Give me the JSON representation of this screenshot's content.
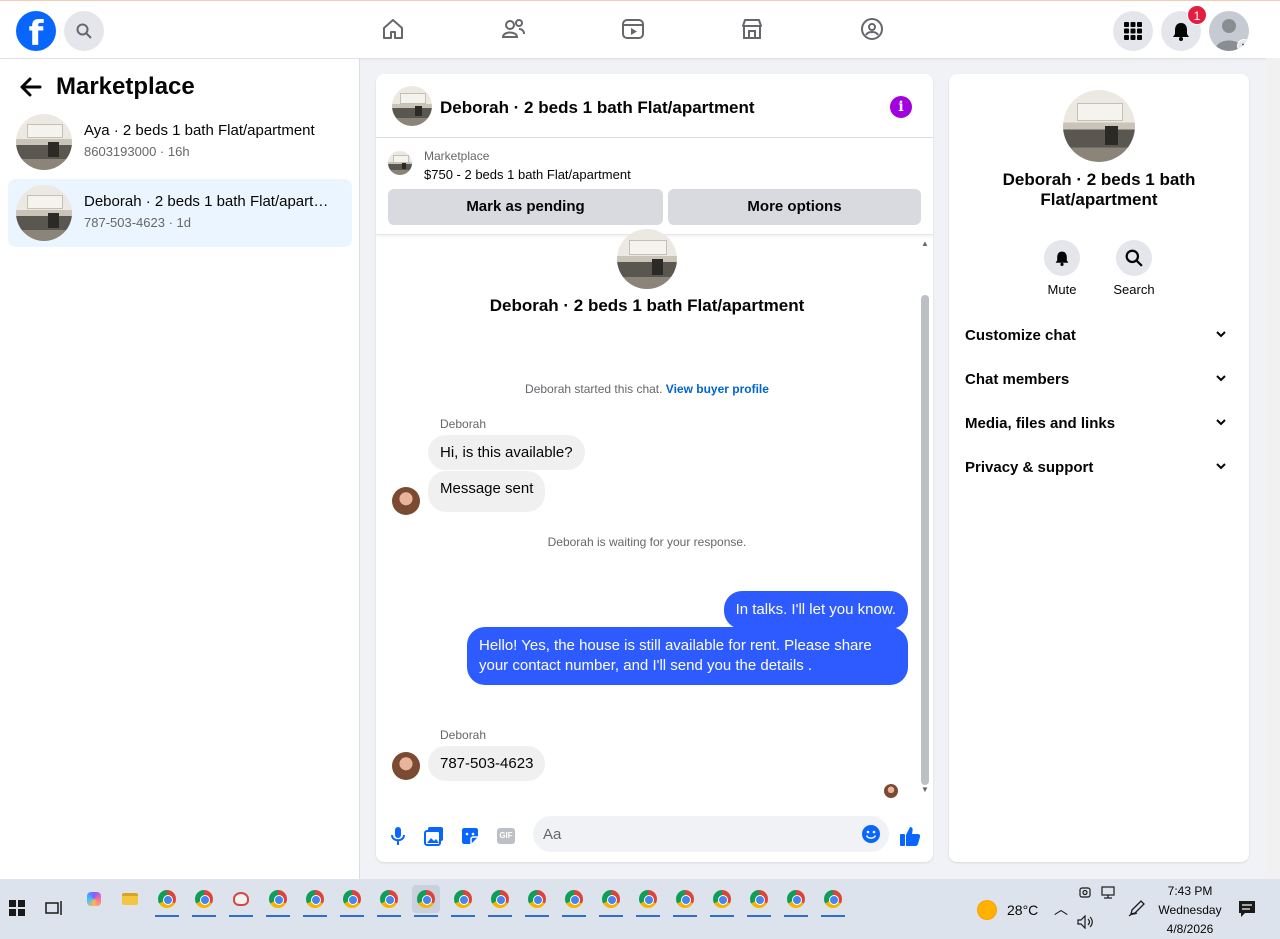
{
  "topbar": {
    "logo": "f",
    "notification_count": "1",
    "icons": [
      "search-icon",
      "home-icon",
      "friends-icon",
      "video-icon",
      "marketplace-icon",
      "groups-icon",
      "menu-grid-icon",
      "bell-icon",
      "profile-avatar"
    ]
  },
  "sidebar": {
    "title": "Marketplace",
    "conversations": [
      {
        "title": "Aya · 2 beds 1 bath Flat/apartment",
        "subtitle": "8603193000 · 16h"
      },
      {
        "title": "Deborah · 2 beds 1 bath Flat/apartment",
        "subtitle": "787-503-4623 · 1d"
      }
    ]
  },
  "chat": {
    "header_title": "Deborah · 2 beds 1 bath Flat/apartment",
    "listing_tag": "Marketplace",
    "listing_price_title": "$750 - 2 beds 1 bath Flat/apartment",
    "mark_pending_label": "Mark as pending",
    "more_options_label": "More options",
    "intro_title": "Deborah · 2 beds 1 bath Flat/apartment",
    "started_text": "Deborah started this chat. ",
    "view_profile_link": "View buyer profile",
    "sender_name_1": "Deborah",
    "msg_in_1": "Hi, is this available?",
    "msg_in_2": "Message sent",
    "waiting_text": "Deborah is waiting for your response.",
    "msg_out_1": "In talks. I'll let you know.",
    "msg_out_2": "Hello! Yes, the house is still available for rent. Please share your contact number, and I'll send you the details .",
    "sender_name_2": "Deborah",
    "msg_in_3": "787-503-4623",
    "composer_placeholder": "Aa",
    "gif_label": "GIF"
  },
  "details": {
    "title": "Deborah · 2 beds 1 bath Flat/apartment",
    "mute_label": "Mute",
    "search_label": "Search",
    "sections": [
      "Customize chat",
      "Chat members",
      "Media, files and links",
      "Privacy & support"
    ]
  },
  "taskbar": {
    "temperature": "28°C",
    "time": "7:43 PM",
    "day": "Wednesday",
    "date": "4/8/2026"
  },
  "colors": {
    "brand": "#0866ff",
    "outgoing_bubble": "#2e5bff",
    "info_icon": "#a300e0",
    "badge": "#e41e3f"
  }
}
